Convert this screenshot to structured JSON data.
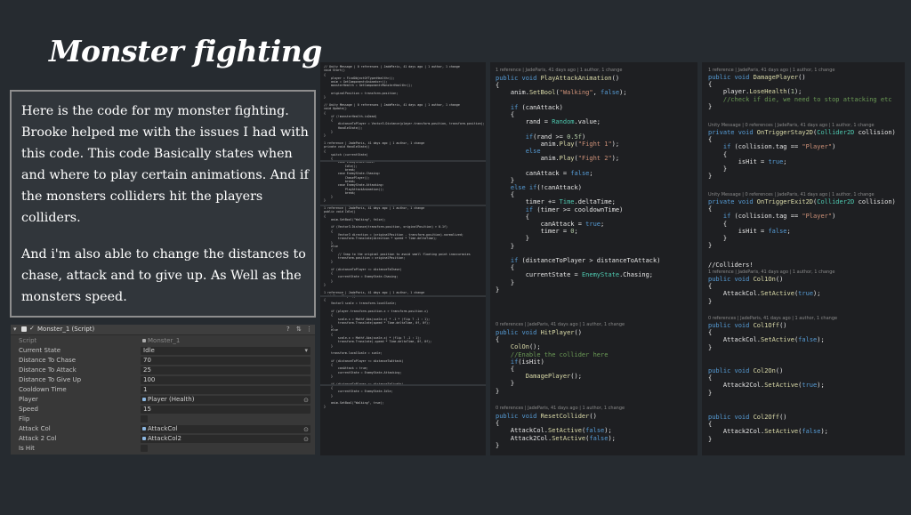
{
  "title": "Monster fighting",
  "description": {
    "p1": "Here is the code for my monster fighting. Brooke helped me with the issues I had with this code. This code Basically states when and where to play certain animations. And if the monsters colliders hit the players colliders.",
    "p2": "And i'm also able to change the distances to chase, attack and to give up. As Well as the monsters speed."
  },
  "inspector": {
    "component_name": "Monster_1 (Script)",
    "fields": [
      {
        "label": "Script",
        "value": "Monster_1"
      },
      {
        "label": "Current State",
        "value": "Idle"
      },
      {
        "label": "Distance To Chase",
        "value": "70"
      },
      {
        "label": "Distance To Attack",
        "value": "25"
      },
      {
        "label": "Distance To Give Up",
        "value": "100"
      },
      {
        "label": "Cooldown Time",
        "value": "1"
      },
      {
        "label": "Player",
        "value": "Player (Health)"
      },
      {
        "label": "Speed",
        "value": "15"
      },
      {
        "label": "Flip",
        "value": ""
      },
      {
        "label": "Attack Col",
        "value": "AttackCol"
      },
      {
        "label": "Attack 2 Col",
        "value": "AttackCol2"
      },
      {
        "label": "Is Hit",
        "value": ""
      }
    ]
  },
  "code_panel_1": {
    "text": "// Unity Message | 0 references | JadeParis, 41 days ago | 1 author, 1 change\nvoid Start()\n{\n    player = FindObjectOfType<Health>();\n    anim = GetComponent<Animator>();\n    monsterHealth = GetComponent<MonsterHealth>();\n\n    originalPosition = transform.position;\n}\n\n// Unity Message | 0 references | JadeParis, 41 days ago | 1 author, 1 change\nvoid Update()\n{\n    if (!monsterHealth.isDead)\n    {\n        distanceToPlayer = Vector3.Distance(player.transform.position, transform.position);\n        HandleState();\n    }\n}\n\n1 reference | JadeParis, 41 days ago | 1 author, 1 change\nprivate void HandleState()\n{\n    switch (currentState)\n    {\n        case EnemyState.Idle:\n            Idle();\n            break;\n        case EnemyState.Chasing:\n            ChasePlayer();\n            break;\n        case EnemyState.Attacking:\n            PlayAttackAnimation();\n            break;\n    }\n}\n\n1 reference | JadeParis, 41 days ago | 1 author, 1 change\npublic void Idle()\n{\n    anim.SetBool(\"Walking\", false);\n\n    if (Vector3.Distance(transform.position, originalPosition) > 0.1f)\n    {\n        Vector3 direction = (originalPosition - transform.position).normalized;\n        transform.Translate(direction * speed * Time.deltaTime);\n    }\n    else\n    {\n        // Snap to the original position to avoid small floating point inaccuracies\n        transform.position = originalPosition;\n    }\n\n    if (distanceToPlayer <= distanceToChase)\n    {\n        currentState = EnemyState.Chasing;\n    }\n}\n\n1 reference | JadeParis, 41 days ago | 1 author, 1 change\nvoid ChasePlayer()\n{\n    Vector3 scale = transform.localScale;\n\n    if (player.transform.position.x > transform.position.x)\n    {\n        scale.x = Mathf.Abs(scale.x) * -1 * (flip ? -1 : 1);\n        transform.Translate(speed * Time.deltaTime, 0f, 0f);\n    }\n    else\n    {\n        scale.x = Mathf.Abs(scale.x) * (flip ? -1 : 1);\n        transform.Translate(-speed * Time.deltaTime, 0f, 0f);\n    }\n\n    transform.localScale = scale;\n\n    if (distanceToPlayer <= distanceToAttack)\n    {\n        canAttack = true;\n        currentState = EnemyState.Attacking;\n    }\n\n    if (distanceToPlayer >= distanceToGiveUp)\n    {\n        currentState = EnemyState.Idle;\n    }\n\n    anim.SetBool(\"Walking\", true);\n}"
  },
  "code_panel_2": {
    "ref_top": "1 reference | JadeParis, 41 days ago | 1 author, 1 change",
    "text_top": "public void PlayAttackAnimation()\n{\n    anim.SetBool(\"Walking\", false);\n\n    if (canAttack)\n    {\n        rand = Random.value;\n\n        if(rand >= 0.5f)\n            anim.Play(\"Fight 1\");\n        else\n            anim.Play(\"Fight 2\");\n\n        canAttack = false;\n    }\n    else if(!canAttack)\n    {\n        timer += Time.deltaTime;\n        if (timer >= cooldownTime)\n        {\n            canAttack = true;\n            timer = 0;\n        }\n    }\n\n    if (distanceToPlayer > distanceToAttack)\n    {\n        currentState = EnemyState.Chasing;\n    }\n}",
    "ref_mid": "0 references | JadeParis, 41 days ago | 1 author, 1 change",
    "text_mid": "public void HitPlayer()\n{\n    ColOn();\n    //Enable the collider here\n    if(isHit)\n    {\n        DamagePlayer();\n    }\n}",
    "ref_bot": "0 references | JadeParis, 41 days ago | 1 author, 1 change",
    "text_bot": "public void ResetCollider()\n{\n    AttackCol.SetActive(false);\n    Attack2Col.SetActive(false);\n}"
  },
  "code_panel_3": {
    "ref_1": "1 reference | JadeParis, 41 days ago | 1 author, 1 change",
    "text_1": "public void DamagePlayer()\n{\n    player.LoseHealth(1);\n    //check if die, we need to stop attacking etc\n}",
    "ref_2": "Unity Message | 0 references | JadeParis, 41 days ago | 1 author, 1 change",
    "text_2": "private void OnTriggerStay2D(Collider2D collision)\n{\n    if (collision.tag == \"Player\")\n    {\n        isHit = true;\n    }\n}",
    "ref_3": "Unity Message | 0 references | JadeParis, 41 days ago | 1 author, 1 change",
    "text_3": "private void OnTriggerExit2D(Collider2D collision)\n{\n    if (collision.tag == \"Player\")\n    {\n        isHit = false;\n    }\n}",
    "comment_4": "//Colliders!",
    "ref_4": "1 reference | JadeParis, 41 days ago | 1 author, 1 change",
    "text_4": "public void Col1On()\n{\n    AttackCol.SetActive(true);\n}",
    "ref_5": "0 references | JadeParis, 41 days ago | 1 author, 1 change",
    "text_5": "public void Col1Off()\n{\n    AttackCol.SetActive(false);\n}",
    "text_6": "public void Col2On()\n{\n    Attack2Col.SetActive(true);\n}",
    "text_7": "public void Col2Off()\n{\n    Attack2Col.SetActive(false);\n}"
  },
  "colors": {
    "background": "#262b30",
    "code_background": "#1e1f22",
    "keyword": "#569cd6",
    "method": "#dcdcaa",
    "string": "#ce9178",
    "comment": "#6a9955"
  }
}
